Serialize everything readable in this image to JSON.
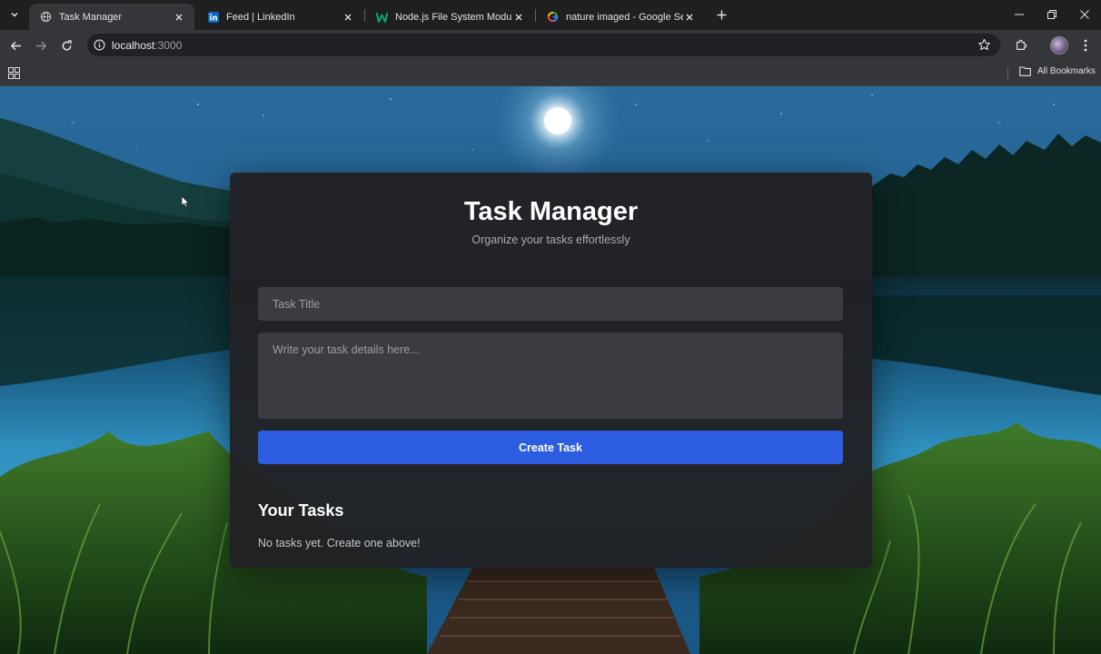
{
  "browser": {
    "tabs": [
      {
        "title": "Task Manager",
        "icon": "globe-icon",
        "active": true
      },
      {
        "title": "Feed | LinkedIn",
        "icon": "linkedin-icon",
        "active": false
      },
      {
        "title": "Node.js File System Module",
        "icon": "w3schools-icon",
        "active": false
      },
      {
        "title": "nature imaged - Google Search",
        "icon": "google-icon",
        "active": false
      }
    ],
    "address": {
      "host": "localhost",
      "port": ":3000"
    },
    "bookmarks": {
      "all_label": "All Bookmarks"
    }
  },
  "app": {
    "title": "Task Manager",
    "subtitle": "Organize your tasks effortlessly",
    "form": {
      "title_placeholder": "Task Title",
      "title_value": "",
      "details_placeholder": "Write your task details here...",
      "details_value": "",
      "submit_label": "Create Task"
    },
    "tasks_section": {
      "title": "Your Tasks",
      "empty_text": "No tasks yet. Create one above!",
      "items": []
    }
  },
  "colors": {
    "accent": "#2c5ce0",
    "card_bg": "#212124",
    "input_bg": "#3b3c41"
  }
}
